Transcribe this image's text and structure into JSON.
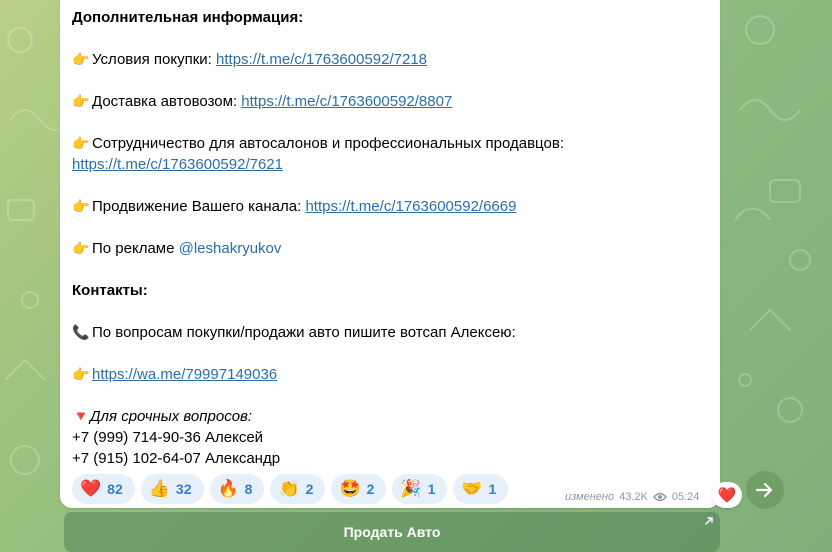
{
  "message": {
    "heading_additional": "Дополнительная информация:",
    "item_purchase_label": "Условия покупки: ",
    "item_purchase_link": "https://t.me/c/1763600592/7218",
    "item_delivery_label": "Доставка автовозом: ",
    "item_delivery_link": "https://t.me/c/1763600592/8807",
    "item_partnership_label": "Сотрудничество для автосалонов и профессиональных продавцов:",
    "item_partnership_link": "https://t.me/c/1763600592/7621",
    "item_promotion_label": "Продвижение Вашего канала: ",
    "item_promotion_link": "https://t.me/c/1763600592/6669",
    "item_ads_label": "По рекламе ",
    "item_ads_mention": "@leshakryukov",
    "heading_contacts": "Контакты:",
    "phone_note": "По вопросам покупки/продажи авто пишите вотсап Алексею:",
    "whatsapp_link": "https://wa.me/79997149036",
    "urgent_label": "Для срочных вопросов:",
    "phone_1": "+7 (999) 714-90-36 Алексей",
    "phone_2": "+7 (915) 102-64-07 Александр"
  },
  "emojis": {
    "pointer": "👉",
    "phone": "📞",
    "red_triangle": "🔻"
  },
  "reactions": [
    {
      "emoji": "❤️",
      "count": "82"
    },
    {
      "emoji": "👍",
      "count": "32"
    },
    {
      "emoji": "🔥",
      "count": "8"
    },
    {
      "emoji": "👏",
      "count": "2"
    },
    {
      "emoji": "🤩",
      "count": "2"
    },
    {
      "emoji": "🎉",
      "count": "1"
    },
    {
      "emoji": "🤝",
      "count": "1"
    }
  ],
  "meta": {
    "edited": "изменено",
    "views": "43.2K",
    "time": "05:24"
  },
  "heart_badge": "❤️",
  "bot_button": {
    "label": "Продать Авто"
  },
  "colors": {
    "link": "#2b6ea8",
    "reaction_bg": "#e5f0fa",
    "reaction_text": "#3a7ec0",
    "heart": "#e53935"
  }
}
